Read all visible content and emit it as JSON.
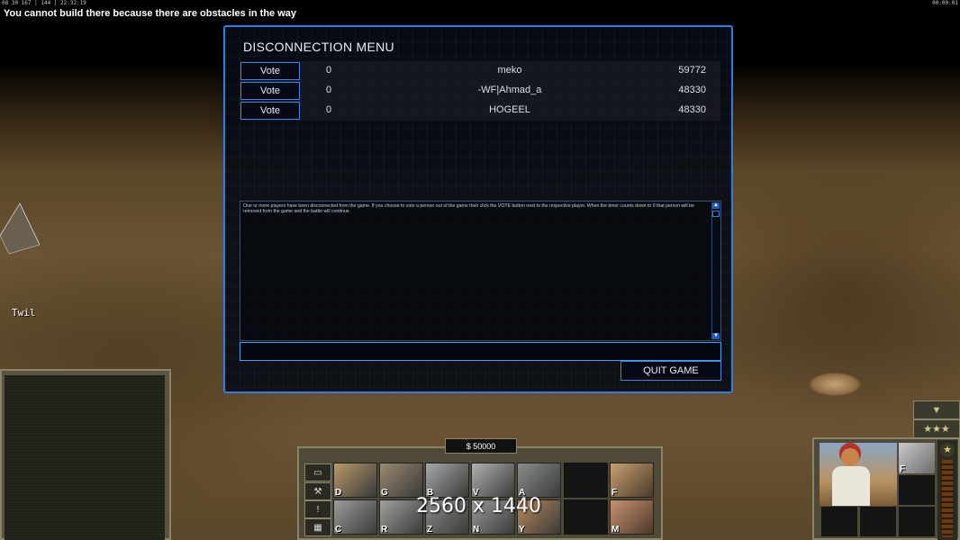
{
  "hud": {
    "top_left_stats": "08 30 167 | 144 | 22:32:19",
    "top_right_timer": "00:00:01",
    "message": "You cannot build there because there are obstacles in the way",
    "player_label": "Twil",
    "money": "$ 50000",
    "resolution_watermark": "2560 x 1440"
  },
  "dialog": {
    "title": "DISCONNECTION MENU",
    "vote_label": "Vote",
    "players": [
      {
        "votes": "0",
        "name": "meko",
        "ping": "59772"
      },
      {
        "votes": "0",
        "name": "-WF|Ahmad_a",
        "ping": "48330"
      },
      {
        "votes": "0",
        "name": "HOGEEL",
        "ping": "48330"
      }
    ],
    "info_text": "One or more players have been disconnected from the game. If you choose to vote a person out of the game then click the VOTE button next to the respective player. When the timer counts down to 0 that person will be removed from the game and the battle will continue.",
    "chat_value": "",
    "quit_label": "QUIT GAME"
  },
  "command_bar": {
    "side_buttons": [
      "▭",
      "⚒",
      "!",
      "▦"
    ],
    "build_row_1": [
      {
        "key": "D",
        "color": "#b89868"
      },
      {
        "key": "G",
        "color": "#9a8a70"
      },
      {
        "key": "B",
        "color": "#a8a8a8"
      },
      {
        "key": "V",
        "color": "#b0b0b0"
      },
      {
        "key": "A",
        "color": "#8c8c8c"
      }
    ],
    "build_row_2": [
      {
        "key": "C",
        "color": "#9c9c9c"
      },
      {
        "key": "R",
        "color": "#a0a0a0"
      },
      {
        "key": "Z",
        "color": "#8a8a8a"
      },
      {
        "key": "N",
        "color": "#9a9a9a"
      },
      {
        "key": "Y",
        "color": "#b88a5a"
      }
    ],
    "right_buttons": [
      {
        "key": "F",
        "color": "#c9a070"
      },
      {
        "key": "M",
        "color": "#c89070"
      }
    ]
  },
  "unit_panel": {
    "hotkey": "F",
    "rank_star": "★",
    "down_arrow": "▼",
    "stars": "★★★"
  }
}
